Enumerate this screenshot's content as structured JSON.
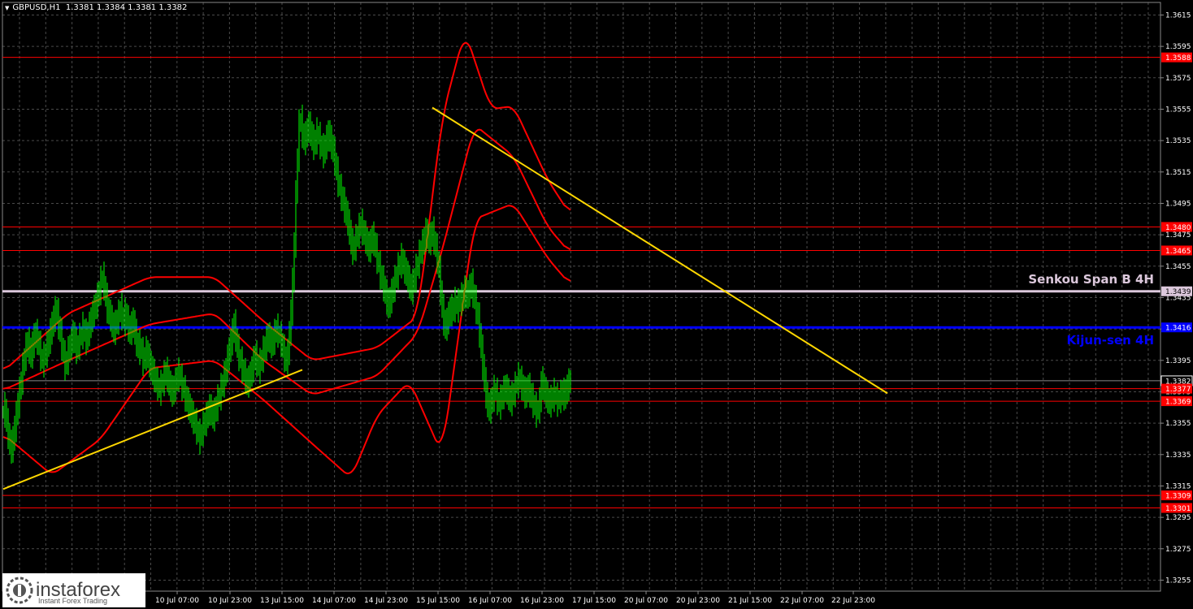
{
  "header": {
    "symbol": "GBPUSD,H1",
    "ohlc": "1.3381 1.3384 1.3381 1.3382"
  },
  "labels": {
    "senkou": "Senkou Span B 4H",
    "kijun": "Kijun-sen 4H"
  },
  "logo": {
    "brand": "instaforex",
    "tagline": "Instant Forex Trading"
  },
  "colors": {
    "background": "#000000",
    "grid": "#4a4a4a",
    "candles": "#00ff00",
    "bollinger": "#ff0000",
    "trendline": "#ffd700",
    "senkou": "#dcc8dc",
    "kijun": "#0000ff",
    "level": "#ff0000",
    "axis_text": "#ffffff"
  },
  "chart_data": {
    "type": "line",
    "symbol": "GBPUSD",
    "timeframe": "H1",
    "ylim": [
      1.3248,
      1.3623
    ],
    "y_ticks": [
      1.3615,
      1.3595,
      1.3575,
      1.3555,
      1.3535,
      1.3515,
      1.3495,
      1.3475,
      1.3455,
      1.3435,
      1.3415,
      1.3395,
      1.3375,
      1.3355,
      1.3335,
      1.3315,
      1.3295,
      1.3275,
      1.3255
    ],
    "x_ticks": [
      "10 Jul 07:00",
      "10 Jul 23:00",
      "13 Jul 15:00",
      "14 Jul 07:00",
      "14 Jul 23:00",
      "15 Jul 15:00",
      "16 Jul 07:00",
      "16 Jul 23:00",
      "17 Jul 15:00",
      "20 Jul 07:00",
      "20 Jul 23:00",
      "21 Jul 15:00",
      "22 Jul 07:00",
      "22 Jul 23:00"
    ],
    "grid": true,
    "horizontal_levels": [
      {
        "value": 1.3588,
        "label": "1.3588",
        "color": "#ff0000"
      },
      {
        "value": 1.348,
        "label": "1.3480",
        "color": "#ff0000"
      },
      {
        "value": 1.3465,
        "label": "1.3465",
        "color": "#ff0000"
      },
      {
        "value": 1.3439,
        "label": "1.3439",
        "color": "#dcc8dc",
        "name": "Senkou Span B 4H"
      },
      {
        "value": 1.3416,
        "label": "1.3416",
        "color": "#0000ff",
        "name": "Kijun-sen 4H"
      },
      {
        "value": 1.3382,
        "label": "1.3382",
        "color": "#ffffff",
        "current": true
      },
      {
        "value": 1.3377,
        "label": "1.3377",
        "color": "#ff0000"
      },
      {
        "value": 1.3369,
        "label": "1.3369",
        "color": "#ff0000"
      },
      {
        "value": 1.3309,
        "label": "1.3309",
        "color": "#ff0000"
      },
      {
        "value": 1.3301,
        "label": "1.3301",
        "color": "#ff0000"
      }
    ],
    "trendlines": [
      {
        "from": {
          "bar": 0,
          "price": 1.3313
        },
        "to": {
          "bar": 184,
          "price": 1.3389
        }
      },
      {
        "from": {
          "bar": 264,
          "price": 1.3556
        },
        "to": {
          "bar": 544,
          "price": 1.3374
        }
      }
    ],
    "close": [
      1.3362,
      1.3365,
      1.3355,
      1.3348,
      1.3342,
      1.3338,
      1.3345,
      1.3352,
      1.336,
      1.3368,
      1.3375,
      1.3383,
      1.339,
      1.3398,
      1.3403,
      1.3407,
      1.3402,
      1.3398,
      1.3405,
      1.341,
      1.3412,
      1.3408,
      1.3404,
      1.3398,
      1.3394,
      1.3397,
      1.34,
      1.3404,
      1.3408,
      1.3413,
      1.3418,
      1.3422,
      1.3427,
      1.3425,
      1.3418,
      1.3412,
      1.3405,
      1.3398,
      1.3392,
      1.3395,
      1.3401,
      1.3404,
      1.3408,
      1.3412,
      1.3407,
      1.3402,
      1.3405,
      1.3409,
      1.3412,
      1.3416,
      1.3412,
      1.3408,
      1.3413,
      1.3417,
      1.3421,
      1.3425,
      1.3428,
      1.3431,
      1.3435,
      1.344,
      1.3445,
      1.3448,
      1.3443,
      1.3435,
      1.3428,
      1.3425,
      1.3422,
      1.3418,
      1.3414,
      1.3418,
      1.3421,
      1.3424,
      1.3428,
      1.3424,
      1.342,
      1.3425,
      1.3421,
      1.3416,
      1.3413,
      1.3418,
      1.342,
      1.3412,
      1.3407,
      1.3402,
      1.3405,
      1.34,
      1.3395,
      1.3398,
      1.3401,
      1.3397,
      1.3393,
      1.339,
      1.3387,
      1.3384,
      1.3381,
      1.3379,
      1.3376,
      1.3379,
      1.3382,
      1.3385,
      1.3388,
      1.3384,
      1.338,
      1.3377,
      1.3374,
      1.3378,
      1.3381,
      1.3385,
      1.3387,
      1.3383,
      1.3379,
      1.3376,
      1.3372,
      1.3369,
      1.3366,
      1.3363,
      1.336,
      1.3357,
      1.3355,
      1.3351,
      1.3348,
      1.3345,
      1.335,
      1.3353,
      1.3356,
      1.3359,
      1.3362,
      1.3365,
      1.3362,
      1.3359,
      1.3362,
      1.3366,
      1.337,
      1.3373,
      1.3377,
      1.3381,
      1.3385,
      1.339,
      1.3396,
      1.3402,
      1.3407,
      1.3413,
      1.3418,
      1.341,
      1.3402,
      1.3398,
      1.3394,
      1.339,
      1.3387,
      1.3383,
      1.338,
      1.3383,
      1.3386,
      1.339,
      1.3395,
      1.3398,
      1.3394,
      1.339,
      1.3393,
      1.3397,
      1.3401,
      1.3404,
      1.3408,
      1.3411,
      1.3408,
      1.3405,
      1.3408,
      1.3412,
      1.3415,
      1.3413,
      1.341,
      1.3407,
      1.3402,
      1.3397,
      1.3395,
      1.34,
      1.3412,
      1.3426,
      1.3445,
      1.347,
      1.35,
      1.3525,
      1.3545,
      1.3548,
      1.354,
      1.3535,
      1.3538,
      1.3542,
      1.3545,
      1.354,
      1.3536,
      1.3532,
      1.3536,
      1.354,
      1.3537,
      1.3533,
      1.353,
      1.3527,
      1.3532,
      1.3536,
      1.354,
      1.3536,
      1.3532,
      1.3528,
      1.3522,
      1.3515,
      1.3509,
      1.3504,
      1.35,
      1.3496,
      1.3492,
      1.3488,
      1.3483,
      1.3477,
      1.347,
      1.3465,
      1.3468,
      1.3472,
      1.3476,
      1.3479,
      1.3482,
      1.3478,
      1.3475,
      1.3472,
      1.3469,
      1.3466,
      1.347,
      1.3474,
      1.3471,
      1.3466,
      1.346,
      1.3455,
      1.345,
      1.3446,
      1.3442,
      1.3438,
      1.3433,
      1.343,
      1.3434,
      1.3438,
      1.3442,
      1.3446,
      1.345,
      1.3454,
      1.3457,
      1.346,
      1.3456,
      1.3453,
      1.345,
      1.3447,
      1.3443,
      1.344,
      1.3444,
      1.3448,
      1.3453,
      1.3457,
      1.3462,
      1.3466,
      1.3469,
      1.3473,
      1.3477,
      1.3474,
      1.3471,
      1.3474,
      1.3477,
      1.3472,
      1.3466,
      1.346,
      1.3452,
      1.344,
      1.3428,
      1.342,
      1.3416,
      1.342,
      1.3424,
      1.3428,
      1.3426,
      1.3429,
      1.3432,
      1.3429,
      1.3431,
      1.3435,
      1.3433,
      1.3437,
      1.344,
      1.3436,
      1.3438,
      1.3441,
      1.3444,
      1.3438,
      1.3433,
      1.3428,
      1.3422,
      1.3413,
      1.3402,
      1.3392,
      1.3382,
      1.3373,
      1.3367,
      1.3364,
      1.3368,
      1.3372,
      1.3376,
      1.3374,
      1.337,
      1.3367,
      1.337,
      1.3373,
      1.3376,
      1.3378,
      1.3375,
      1.3372,
      1.3369,
      1.3372,
      1.3375,
      1.3378,
      1.3381,
      1.3384,
      1.3382,
      1.3379,
      1.3376,
      1.3373,
      1.3376,
      1.3378,
      1.3374,
      1.3371,
      1.3368,
      1.3365,
      1.3362,
      1.3365,
      1.3368,
      1.3382,
      1.3379,
      1.3376,
      1.3373,
      1.337,
      1.3368,
      1.337,
      1.3372,
      1.3374,
      1.3371,
      1.3369,
      1.3371,
      1.3373,
      1.3375,
      1.3372,
      1.3375,
      1.3378,
      1.3381,
      1.3382
    ],
    "bollinger": {
      "upper": [
        [
          0,
          1.3388
        ],
        [
          40,
          1.3425
        ],
        [
          90,
          1.3448
        ],
        [
          130,
          1.3448
        ],
        [
          160,
          1.342
        ],
        [
          190,
          1.3395
        ],
        [
          230,
          1.3403
        ],
        [
          255,
          1.3423
        ],
        [
          270,
          1.355
        ],
        [
          284,
          1.3605
        ],
        [
          300,
          1.3555
        ],
        [
          314,
          1.3557
        ],
        [
          335,
          1.351
        ],
        [
          360,
          1.347
        ],
        [
          380,
          1.3465
        ],
        [
          400,
          1.3475
        ],
        [
          415,
          1.3482
        ],
        [
          435,
          1.3473
        ],
        [
          455,
          1.345
        ],
        [
          470,
          1.3468
        ],
        [
          478,
          1.3398
        ],
        [
          500,
          1.3385
        ],
        [
          520,
          1.3385
        ],
        [
          544,
          1.3383
        ]
      ],
      "middle": [
        [
          0,
          1.3376
        ],
        [
          40,
          1.3395
        ],
        [
          90,
          1.3418
        ],
        [
          130,
          1.3425
        ],
        [
          160,
          1.3395
        ],
        [
          190,
          1.3373
        ],
        [
          230,
          1.3385
        ],
        [
          255,
          1.3412
        ],
        [
          270,
          1.3465
        ],
        [
          290,
          1.3545
        ],
        [
          314,
          1.3525
        ],
        [
          335,
          1.348
        ],
        [
          360,
          1.345
        ],
        [
          380,
          1.345
        ],
        [
          400,
          1.3462
        ],
        [
          415,
          1.3465
        ],
        [
          435,
          1.3448
        ],
        [
          455,
          1.3432
        ],
        [
          470,
          1.3412
        ],
        [
          478,
          1.339
        ],
        [
          500,
          1.3378
        ],
        [
          520,
          1.3375
        ],
        [
          544,
          1.3375
        ]
      ],
      "lower": [
        [
          0,
          1.3348
        ],
        [
          30,
          1.3322
        ],
        [
          60,
          1.3345
        ],
        [
          90,
          1.339
        ],
        [
          130,
          1.3395
        ],
        [
          160,
          1.337
        ],
        [
          190,
          1.3342
        ],
        [
          214,
          1.332
        ],
        [
          230,
          1.336
        ],
        [
          250,
          1.3382
        ],
        [
          270,
          1.3335
        ],
        [
          290,
          1.3485
        ],
        [
          314,
          1.3495
        ],
        [
          335,
          1.346
        ],
        [
          360,
          1.343
        ],
        [
          380,
          1.3437
        ],
        [
          400,
          1.3447
        ],
        [
          415,
          1.3437
        ],
        [
          435,
          1.342
        ],
        [
          455,
          1.341
        ],
        [
          478,
          1.3348
        ],
        [
          500,
          1.3358
        ],
        [
          520,
          1.3363
        ],
        [
          544,
          1.3363
        ]
      ]
    }
  }
}
